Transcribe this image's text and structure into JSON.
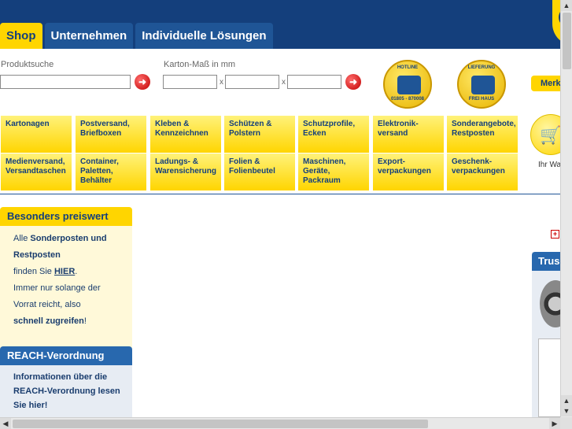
{
  "nav": {
    "tabs": [
      "Shop",
      "Unternehmen",
      "Individuelle Lösungen"
    ]
  },
  "search": {
    "product_label": "Produktsuche",
    "carton_label": "Karton-Maß in mm",
    "times": "x",
    "go_glyph": "➜"
  },
  "badges": {
    "hotline_top": "HOTLINE",
    "hotline_bottom": "01805 - 870008",
    "lieferung_top": "LIEFERUNG",
    "lieferung_bottom": "FREI HAUS"
  },
  "merk_button": "Merk",
  "categories": [
    [
      "Kartonagen",
      "Postversand, Briefboxen",
      "Kleben & Kennzeichnen",
      "Schützen & Polstern",
      "Schutzprofile, Ecken",
      "Elektronik-versand",
      "Sonderangebote, Restposten"
    ],
    [
      "Medienversand, Versandtaschen",
      "Container, Paletten, Behälter",
      "Ladungs- & Warensicherung",
      "Folien & Folienbeutel",
      "Maschinen, Geräte, Packraum",
      "Export-verpackungen",
      "Geschenk-verpackungen"
    ]
  ],
  "cart": {
    "label": "Ihr Wa"
  },
  "box1": {
    "title": "Besonders preiswert",
    "line1a": "Alle ",
    "line1b": "Sonderposten und Restposten",
    "line2a": "finden Sie ",
    "line2b": "HIER",
    "line2c": ".",
    "line3": "Immer nur solange der Vorrat reicht, also",
    "line4a": "schnell zugreifen",
    "line4b": "!"
  },
  "box2": {
    "title": "REACH-Verordnung",
    "text": "Informationen über die REACH-Verordnung lesen Sie hier!"
  },
  "trust": {
    "title": "Trus"
  },
  "colors": {
    "brand_blue": "#143f7c",
    "brand_yellow": "#ffd500",
    "accent_red": "#c00000"
  }
}
